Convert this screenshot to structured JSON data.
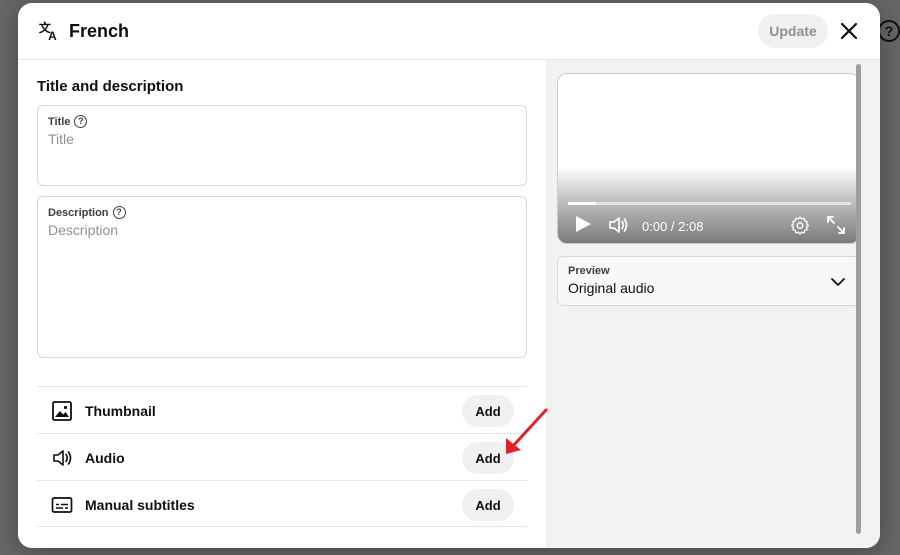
{
  "dialog": {
    "title": "French",
    "update_label": "Update"
  },
  "form": {
    "section_title": "Title and description",
    "title_label": "Title",
    "title_placeholder": "Title",
    "title_value": "",
    "description_label": "Description",
    "description_placeholder": "Description",
    "description_value": ""
  },
  "assets": [
    {
      "label": "Thumbnail",
      "icon": "image-icon",
      "button": "Add"
    },
    {
      "label": "Audio",
      "icon": "speaker-icon",
      "button": "Add"
    },
    {
      "label": "Manual subtitles",
      "icon": "subtitles-icon",
      "button": "Add"
    }
  ],
  "player": {
    "time": "0:00 / 2:08",
    "progress": 0.1
  },
  "preview": {
    "label": "Preview",
    "value": "Original audio"
  },
  "colors": {
    "annotation_arrow": "#e0202a"
  }
}
